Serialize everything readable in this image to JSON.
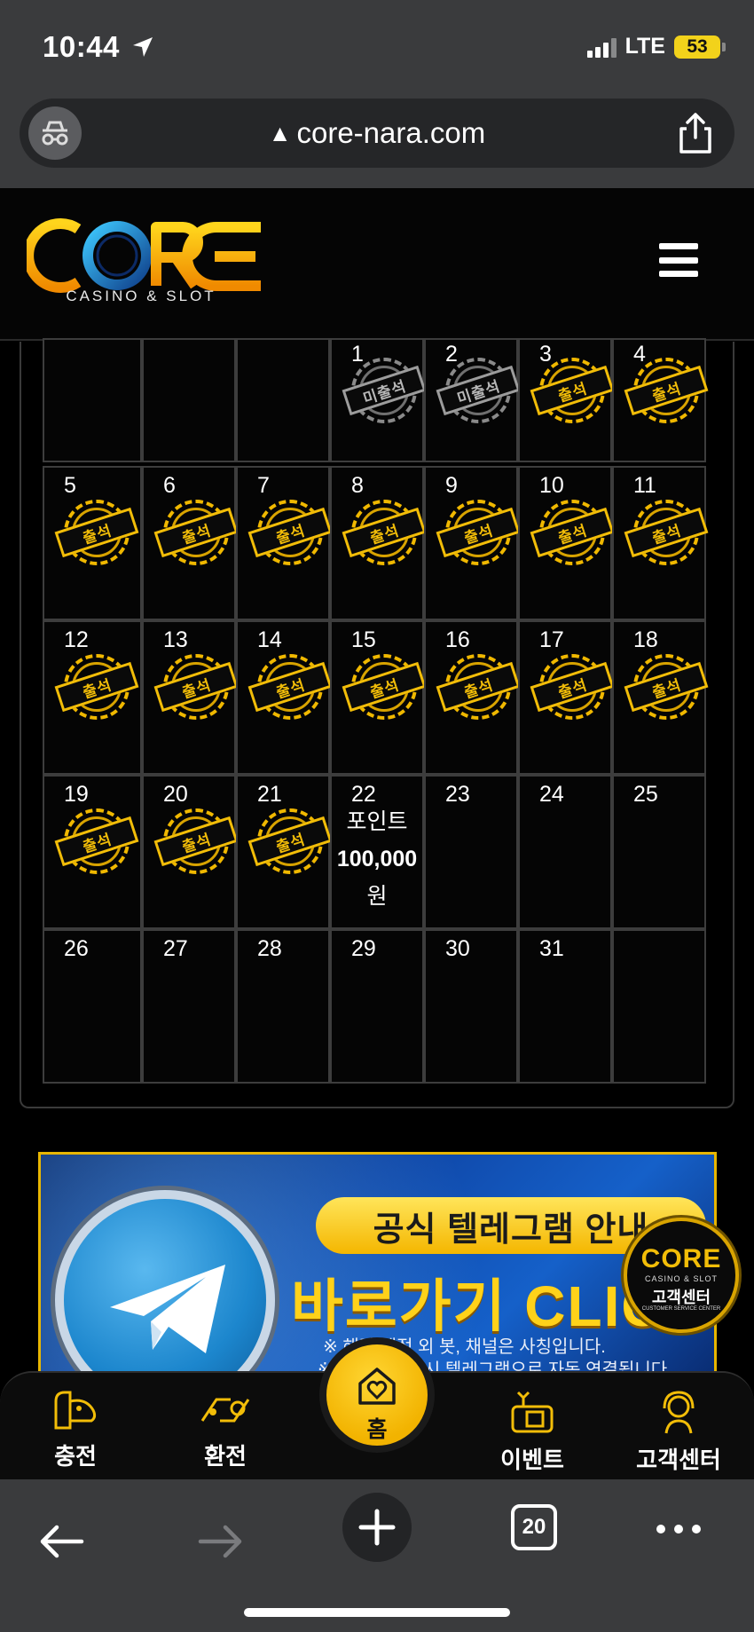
{
  "status_bar": {
    "time": "10:44",
    "network": "LTE",
    "battery": "53"
  },
  "browser": {
    "url": "core-nara.com",
    "warning_glyph": "▲",
    "tab_count": "20"
  },
  "site": {
    "logo_text": "CORE",
    "logo_subtitle": "CASINO & SLOT"
  },
  "calendar": {
    "stamp_present": "출석",
    "stamp_absent": "미출석",
    "weeks": [
      [
        {
          "day": "",
          "stamp": "none"
        },
        {
          "day": "",
          "stamp": "none"
        },
        {
          "day": "",
          "stamp": "none"
        },
        {
          "day": "1",
          "stamp": "absent"
        },
        {
          "day": "2",
          "stamp": "absent"
        },
        {
          "day": "3",
          "stamp": "present"
        },
        {
          "day": "4",
          "stamp": "present"
        }
      ],
      [
        {
          "day": "5",
          "stamp": "present"
        },
        {
          "day": "6",
          "stamp": "present"
        },
        {
          "day": "7",
          "stamp": "present"
        },
        {
          "day": "8",
          "stamp": "present"
        },
        {
          "day": "9",
          "stamp": "present"
        },
        {
          "day": "10",
          "stamp": "present"
        },
        {
          "day": "11",
          "stamp": "present"
        }
      ],
      [
        {
          "day": "12",
          "stamp": "present"
        },
        {
          "day": "13",
          "stamp": "present"
        },
        {
          "day": "14",
          "stamp": "present"
        },
        {
          "day": "15",
          "stamp": "present"
        },
        {
          "day": "16",
          "stamp": "present"
        },
        {
          "day": "17",
          "stamp": "present"
        },
        {
          "day": "18",
          "stamp": "present"
        }
      ],
      [
        {
          "day": "19",
          "stamp": "present"
        },
        {
          "day": "20",
          "stamp": "present"
        },
        {
          "day": "21",
          "stamp": "present"
        },
        {
          "day": "22",
          "stamp": "none",
          "note_line1": "포인트",
          "note_line2": "100,000",
          "note_line3": "원"
        },
        {
          "day": "23",
          "stamp": "none"
        },
        {
          "day": "24",
          "stamp": "none"
        },
        {
          "day": "25",
          "stamp": "none"
        }
      ],
      [
        {
          "day": "26",
          "stamp": "none"
        },
        {
          "day": "27",
          "stamp": "none"
        },
        {
          "day": "28",
          "stamp": "none"
        },
        {
          "day": "29",
          "stamp": "none"
        },
        {
          "day": "30",
          "stamp": "none"
        },
        {
          "day": "31",
          "stamp": "none"
        },
        {
          "day": "",
          "stamp": "none"
        }
      ]
    ]
  },
  "banner": {
    "pill": "공식 텔레그램 안내",
    "title": "바로가기 CLICK",
    "note1": "※ 해당 계정 외 봇, 채널은 사칭입니다.",
    "note2": "※ 이미지 클릭시 텔레그램으로 자동 연결됩니다."
  },
  "support_badge": {
    "logo": "CORE",
    "sub": "CASINO & SLOT",
    "label": "고객센터",
    "sub2": "CUSTOMER SERVICE CENTER"
  },
  "bottom_nav": {
    "charge": "충전",
    "exchange": "환전",
    "home": "홈",
    "event": "이벤트",
    "support": "고객센터"
  },
  "colors": {
    "accent": "#f2bd08",
    "background": "#000000",
    "chrome": "#3a3b3d"
  }
}
